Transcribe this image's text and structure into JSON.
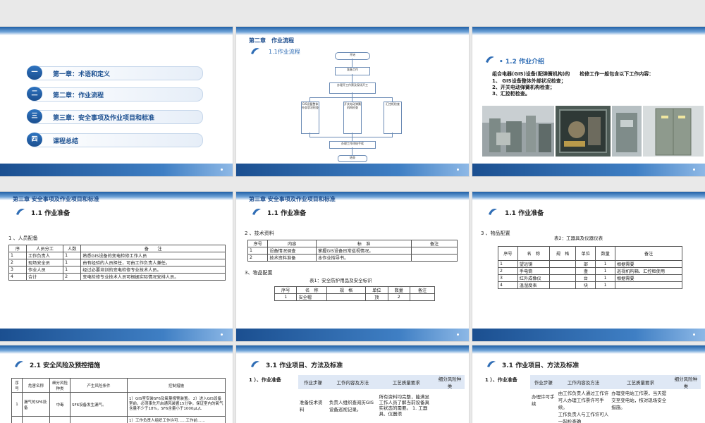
{
  "slide1": {
    "toc": [
      {
        "num": "一",
        "label": "第一章：术语和定义"
      },
      {
        "num": "二",
        "label": "第二章：作业流程"
      },
      {
        "num": "三",
        "label": "第三章：安全事项及作业项目和标准"
      },
      {
        "num": "四",
        "label": "课程总结"
      }
    ]
  },
  "slide2": {
    "chapter": "第二章　作业流程",
    "section": "1.1作业流程",
    "flow": {
      "start": "开始",
      "prep": "准备工作",
      "permit": "办理开工作票及现场开工",
      "b1": "GIS设备整体外部状况检查",
      "b2": "开关电动弹簧机构检查",
      "b3": "汇控柜检查",
      "end_work": "办理工作终结手续",
      "end": "结束"
    }
  },
  "slide3": {
    "section": "• 1.2 作业介绍",
    "intro": "组合电器(GIS)设备(配弹簧机构)的　　检修工作一般包含以下工作内容：",
    "items": [
      "1、 GIS设备整体外部状况检查；",
      "2、开关电动弹簧机构检查；",
      "3、汇控柜检查。"
    ]
  },
  "slide4": {
    "chapter": "第三章 安全事项及作业项目和标准",
    "section": "1.1 作业准备",
    "subtitle": "1 、人员配备",
    "headers": [
      "序",
      "人员分工",
      "人数",
      "备　　注"
    ],
    "rows": [
      [
        "1",
        "工作负责人",
        "1",
        "熟悉GIS设备的变电检修工作人员"
      ],
      [
        "2",
        "现场安全员",
        "1",
        "由有经验的人员担任，可由工作负责人兼任。"
      ],
      [
        "3",
        "作业人员",
        "1",
        "经过必要培训的变电检修专业技术人员。"
      ],
      [
        "4",
        "合计",
        "2",
        "变电检修专业技术人员可根据实际情况安排人员。"
      ]
    ]
  },
  "slide5": {
    "chapter": "第三章 安全事项及作业项目和标准",
    "section": "1.1 作业准备",
    "subtitle": "2 、技术资料",
    "headers": [
      "序号",
      "内容",
      "标　准",
      "备注"
    ],
    "rows": [
      [
        "1",
        "设备情况调查",
        "掌握GIS设备日常巡视情况。",
        ""
      ],
      [
        "2",
        "技术资料准备",
        "本作业指导书。",
        ""
      ]
    ],
    "subtitle2": "3、物品配置",
    "caption": "表1：安全防护用品及安全标识",
    "headers2": [
      "序号",
      "名　称",
      "规　格",
      "单位",
      "数量",
      "备注"
    ],
    "rows2": [
      [
        "1",
        "安全帽",
        "",
        "顶",
        "2",
        ""
      ]
    ]
  },
  "slide6": {
    "section": "1.1 作业准备",
    "subtitle": "3 、物品配置",
    "caption": "表2：工器具及仪器仪表",
    "headers": [
      "序号",
      "名　称",
      "规　格",
      "单位",
      "数量",
      "备注"
    ],
    "rows": [
      [
        "1",
        "望远镜",
        "",
        "部",
        "1",
        "根据需要"
      ],
      [
        "2",
        "手电筒",
        "",
        "盏",
        "1",
        "巡视机构箱、汇控柜使用"
      ],
      [
        "3",
        "红外成像仪",
        "",
        "台",
        "1",
        "根据需要"
      ],
      [
        "4",
        "温湿度表",
        "",
        "块",
        "1",
        ""
      ]
    ]
  },
  "slide7": {
    "section": "2.1 安全风险及预控措施",
    "headers": [
      "序号",
      "危害名称",
      "细分风险种类",
      "产生风险条件",
      "控制措施"
    ],
    "rows": [
      [
        "1",
        "漏气的SF6设备",
        "中毒",
        "SF6设备发生漏气。",
        "1）GIS室安装SF6及氧量报警装置。 2）进入GIS设备室前，必须事先开启通风装置15分钟，保证室内的氧气含量不少于18%，SF6含量小于1000μL/L"
      ]
    ],
    "row2_hint": "1）工作负责人组织工作许可……工作前……"
  },
  "slide8": {
    "section": "3.1 作业项目、方法及标准",
    "label": "1 ）、作业准备",
    "headers": [
      "作业步骤",
      "工作内容及方法",
      "工艺质量要求",
      "细分风险种类"
    ],
    "rows": [
      [
        "准备技术资料",
        "负责人组织查阅历GIS设备巡视记录。",
        "所有资料均完整，能满足工作人员了解当前设备真实状态的需要。 1. 工器具、仪器须",
        ""
      ]
    ]
  },
  "slide9": {
    "section": "3.1 作业项目、方法及标准",
    "label": "1 ）、作业准备",
    "headers": [
      "作业步骤",
      "工作内容及方法",
      "工艺质量要求",
      "细分风险种类"
    ],
    "rows": [
      [
        "办理许可手续",
        "由工作负责人通过工作许可人办理工作票许可手续。",
        "办理变电站工作票，当天提交至变电站，核对现场安全措施。",
        ""
      ],
      [
        "",
        "工作负责人与工作许可人一起检查确",
        "",
        ""
      ]
    ]
  }
}
